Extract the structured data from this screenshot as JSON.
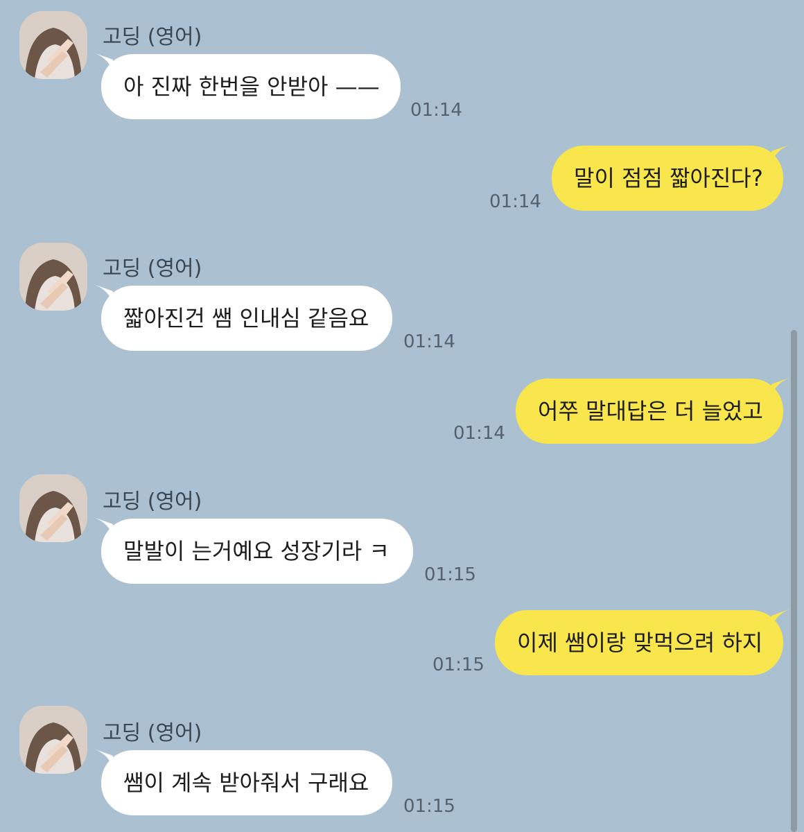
{
  "chat": {
    "sender_name": "고딩 (영어)",
    "messages": [
      {
        "from": "them",
        "text": "아 진짜 한번을 안받아 ——",
        "time": "01:14"
      },
      {
        "from": "me",
        "text": "말이 점점 짧아진다?",
        "time": "01:14"
      },
      {
        "from": "them",
        "text": "짧아진건 쌤 인내심 같음요",
        "time": "01:14"
      },
      {
        "from": "me",
        "text": "어쭈 말대답은 더 늘었고",
        "time": "01:14"
      },
      {
        "from": "them",
        "text": "말발이 는거예요 성장기라 ㅋ",
        "time": "01:15"
      },
      {
        "from": "me",
        "text": "이제 쌤이랑 맞먹으려 하지",
        "time": "01:15"
      },
      {
        "from": "them",
        "text": "쌤이 계속 받아줘서 구래요",
        "time": "01:15"
      }
    ]
  },
  "colors": {
    "background": "#abc0d1",
    "incoming_bubble": "#ffffff",
    "outgoing_bubble": "#f9e64c"
  }
}
